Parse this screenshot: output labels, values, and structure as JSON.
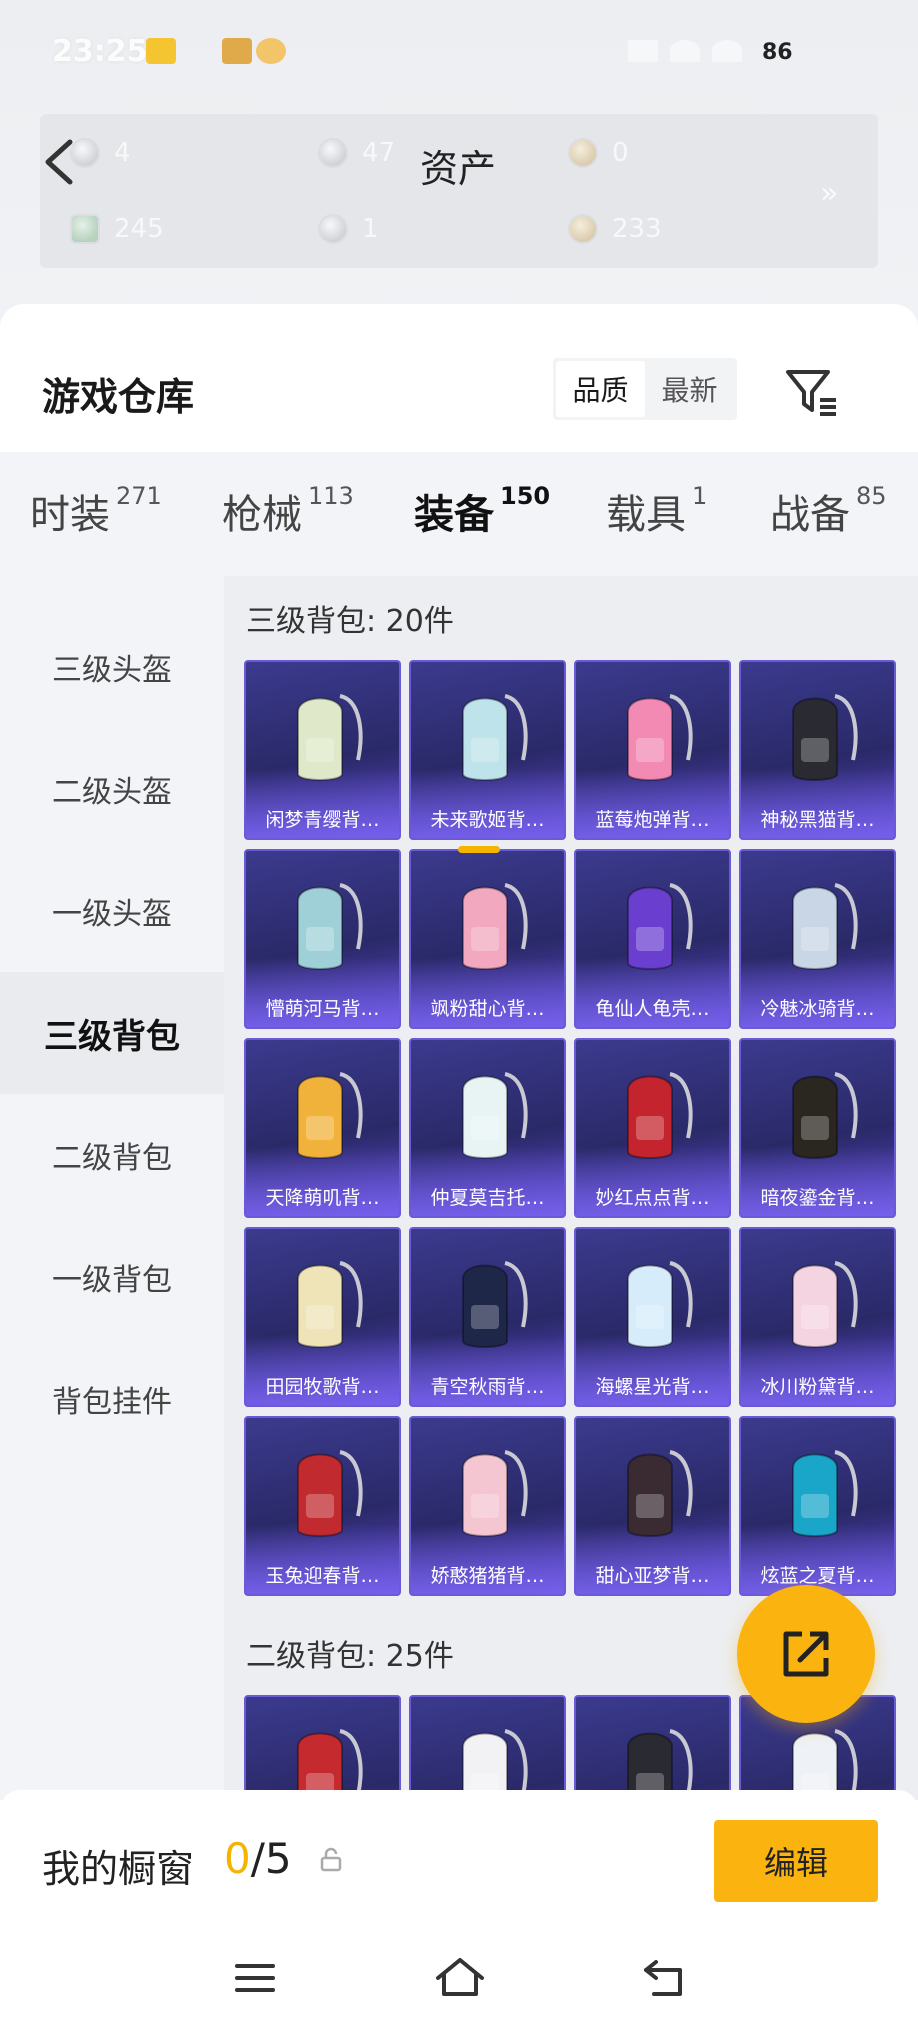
{
  "status_bar": {
    "time": "23:25",
    "battery": "86"
  },
  "assets": {
    "title": "资产",
    "items": [
      {
        "value": "4"
      },
      {
        "value": "47"
      },
      {
        "value": "0"
      },
      {
        "value": "245"
      },
      {
        "value": "1"
      },
      {
        "value": "233"
      }
    ]
  },
  "warehouse": {
    "title": "游戏仓库",
    "sort": {
      "quality": "品质",
      "latest": "最新",
      "active": "quality"
    }
  },
  "tabs": [
    {
      "label": "时装",
      "count": "271"
    },
    {
      "label": "枪械",
      "count": "113"
    },
    {
      "label": "装备",
      "count": "150",
      "active": true
    },
    {
      "label": "载具",
      "count": "1"
    },
    {
      "label": "战备",
      "count": "85"
    }
  ],
  "sidebar": {
    "items": [
      {
        "label": "三级头盔"
      },
      {
        "label": "二级头盔"
      },
      {
        "label": "一级头盔"
      },
      {
        "label": "三级背包",
        "active": true
      },
      {
        "label": "二级背包"
      },
      {
        "label": "一级背包"
      },
      {
        "label": "背包挂件"
      }
    ]
  },
  "sections": [
    {
      "title": "三级背包: 20件",
      "items": [
        {
          "name": "闲梦青缨背…",
          "color": "#dfe8c8"
        },
        {
          "name": "未来歌姬背…",
          "color": "#bfe3ea"
        },
        {
          "name": "蓝莓炮弹背…",
          "color": "#f28ab4"
        },
        {
          "name": "神秘黑猫背…",
          "color": "#2a2a33"
        },
        {
          "name": "懵萌河马背…",
          "color": "#9fd0d8"
        },
        {
          "name": "飒粉甜心背…",
          "color": "#f2a9bf"
        },
        {
          "name": "龟仙人龟壳…",
          "color": "#6a3fd0"
        },
        {
          "name": "冷魅冰骑背…",
          "color": "#c8d6e6"
        },
        {
          "name": "天降萌叽背…",
          "color": "#f0b23a"
        },
        {
          "name": "仲夏莫吉托…",
          "color": "#e8f4f4"
        },
        {
          "name": "妙红点点背…",
          "color": "#c4242e"
        },
        {
          "name": "暗夜鎏金背…",
          "color": "#2a2620"
        },
        {
          "name": "田园牧歌背…",
          "color": "#efe3b8"
        },
        {
          "name": "青空秋雨背…",
          "color": "#1f2748"
        },
        {
          "name": "海螺星光背…",
          "color": "#d7ecfa"
        },
        {
          "name": "冰川粉黛背…",
          "color": "#f3d4e0"
        },
        {
          "name": "玉兔迎春背…",
          "color": "#c12a2f"
        },
        {
          "name": "娇憨猪猪背…",
          "color": "#f4c6d2"
        },
        {
          "name": "甜心亚梦背…",
          "color": "#3a2b33"
        },
        {
          "name": "炫蓝之夏背…",
          "color": "#1aa6c8"
        }
      ]
    },
    {
      "title": "二级背包: 25件",
      "items": [
        {
          "name": "",
          "color": "#c52a2f"
        },
        {
          "name": "",
          "color": "#f2f2f4"
        },
        {
          "name": "",
          "color": "#2a2a32"
        },
        {
          "name": "",
          "color": "#eef1f5"
        }
      ]
    }
  ],
  "showcase": {
    "label": "我的橱窗",
    "current": "0",
    "total": "/5",
    "edit_label": "编辑"
  },
  "colors": {
    "accent": "#fbb40f",
    "card_bg": "#2a2968",
    "card_glow": "#5b47c9"
  }
}
